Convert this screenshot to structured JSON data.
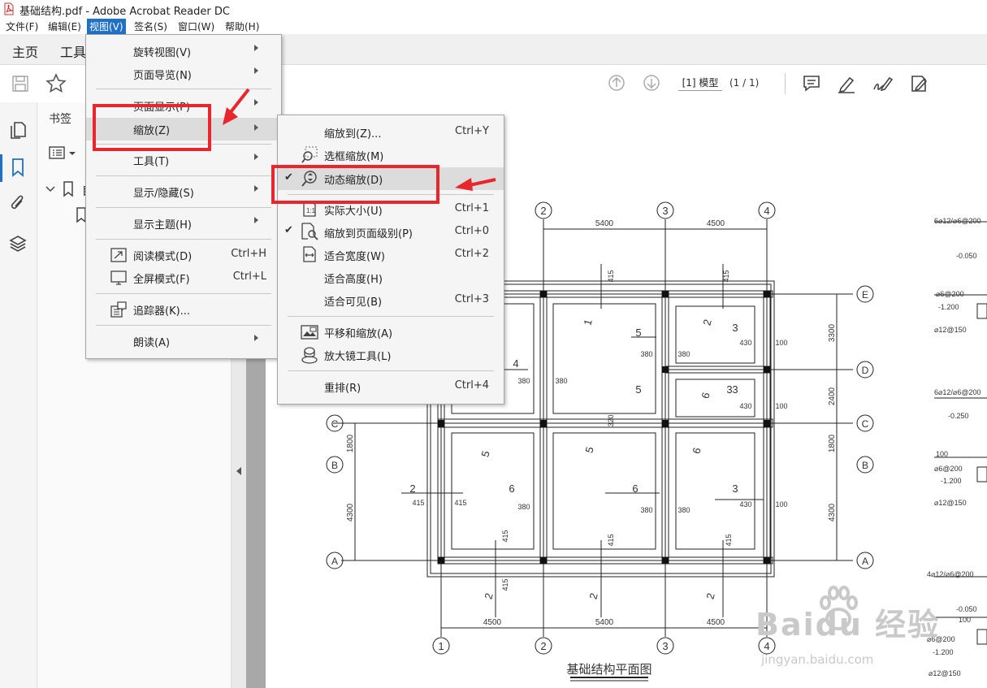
{
  "window": {
    "title": "基础结构.pdf - Adobe Acrobat Reader DC"
  },
  "menubar": {
    "items": [
      "文件(F)",
      "编辑(E)",
      "视图(V)",
      "签名(S)",
      "窗口(W)",
      "帮助(H)"
    ],
    "active": "视图(V)"
  },
  "tabs": {
    "home": "主页",
    "tools": "工具"
  },
  "toolbar": {
    "page_value": "[1] 模型",
    "page_count": "(1 / 1)"
  },
  "bookmarks": {
    "header": "书签",
    "item_prefix": "目"
  },
  "view_menu": {
    "items": [
      {
        "label": "旋转视图(V)",
        "submenu": true
      },
      {
        "label": "页面导览(N)",
        "submenu": true
      },
      {
        "label": "页面显示(P)",
        "submenu": true
      },
      {
        "label": "缩放(Z)",
        "submenu": true,
        "highlighted": true
      },
      {
        "label": "工具(T)",
        "submenu": true
      },
      {
        "label": "显示/隐藏(S)",
        "submenu": true
      },
      {
        "label": "显示主题(H)",
        "submenu": true
      },
      {
        "label": "阅读模式(D)",
        "shortcut": "Ctrl+H",
        "icon": "read-mode-icon"
      },
      {
        "label": "全屏模式(F)",
        "shortcut": "Ctrl+L",
        "icon": "fullscreen-icon"
      },
      {
        "label": "追踪器(K)...",
        "icon": "tracker-icon"
      },
      {
        "label": "朗读(A)",
        "submenu": true
      }
    ]
  },
  "zoom_menu": {
    "items": [
      {
        "label": "缩放到(Z)...",
        "shortcut": "Ctrl+Y"
      },
      {
        "label": "选框缩放(M)",
        "icon": "marquee-zoom-icon"
      },
      {
        "label": "动态缩放(D)",
        "icon": "dynamic-zoom-icon",
        "checked": true,
        "highlighted": true
      },
      {
        "label": "实际大小(U)",
        "shortcut": "Ctrl+1",
        "icon": "actual-size-icon"
      },
      {
        "label": "缩放到页面级别(P)",
        "shortcut": "Ctrl+0",
        "icon": "zoom-to-page-icon",
        "checked": true
      },
      {
        "label": "适合宽度(W)",
        "shortcut": "Ctrl+2",
        "icon": "fit-width-icon"
      },
      {
        "label": "适合高度(H)"
      },
      {
        "label": "适合可见(B)",
        "shortcut": "Ctrl+3"
      },
      {
        "label": "平移和缩放(A)",
        "icon": "pan-zoom-icon"
      },
      {
        "label": "放大镜工具(L)",
        "icon": "loupe-icon"
      },
      {
        "label": "重排(R)",
        "shortcut": "Ctrl+4"
      }
    ]
  },
  "drawing": {
    "title": "基础结构平面图",
    "axes_top": [
      "2",
      "3",
      "4"
    ],
    "axes_bottom": [
      "1",
      "2",
      "3",
      "4"
    ],
    "axes_right": [
      "E",
      "D",
      "C",
      "B",
      "A"
    ],
    "axes_left": [
      "C",
      "B",
      "A"
    ],
    "dims_top": [
      "5400",
      "4500"
    ],
    "dims_bottom": [
      "4500",
      "5400",
      "4500"
    ],
    "dims_right": [
      "3300",
      "2400",
      "1800",
      "4300"
    ],
    "dims_left": [
      "1800",
      "4300"
    ],
    "footing_numbers": [
      "1",
      "5",
      "2",
      "3",
      "4",
      "5",
      "6",
      "3",
      "3",
      "5",
      "6",
      "2",
      "6",
      "6",
      "3",
      "5",
      "2",
      "2",
      "2",
      "2"
    ],
    "small_dims": [
      "415",
      "380",
      "430",
      "100",
      "320"
    ],
    "side_notes": [
      "6⌀12/⌀6@200",
      "-0.050",
      "⌀6@200",
      "-1.200",
      "⌀12@150",
      "6⌀12/⌀6@200",
      "-0.250",
      "100",
      "⌀6@200",
      "-1.200",
      "⌀12@150",
      "4⌀12/⌀6@200",
      "-0.050",
      "100",
      "⌀6@200",
      "-1.200",
      "⌀12@150"
    ]
  },
  "watermark": {
    "brand": "Baidu 经验",
    "url": "jingyan.baidu.com"
  }
}
